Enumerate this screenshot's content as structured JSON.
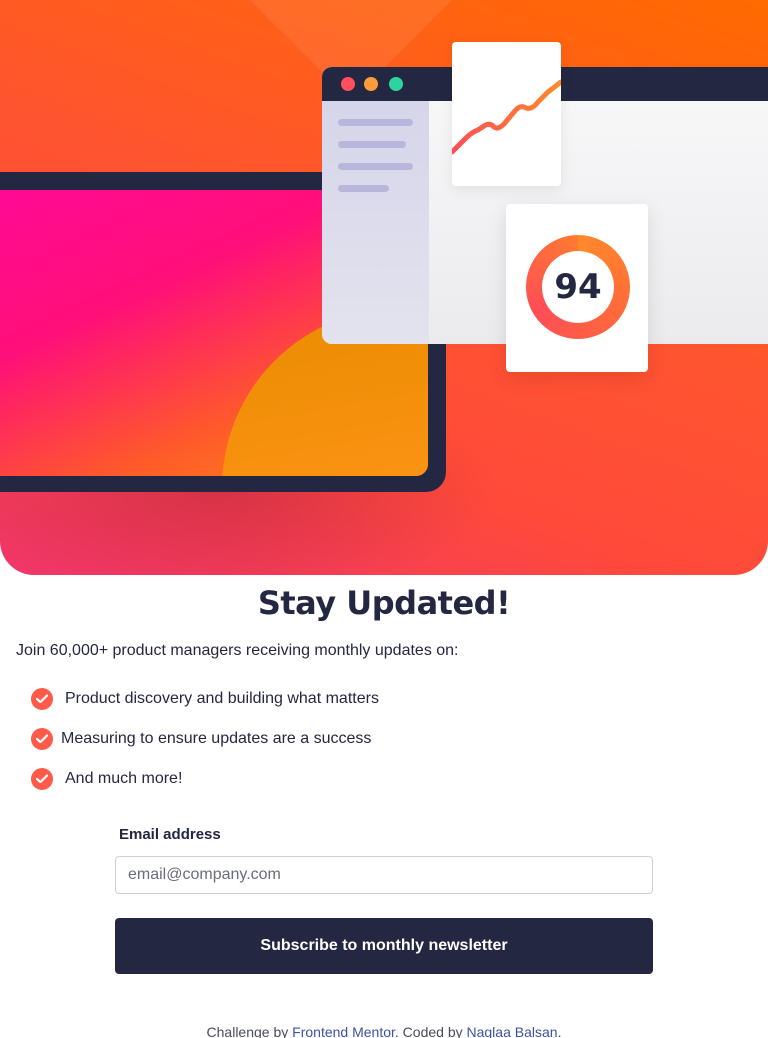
{
  "hero": {
    "score": "94",
    "colors": {
      "accent": "#ff5a4a",
      "dark_navy": "#242742",
      "hero_orange": "#ff6a00",
      "hero_pink": "#ff0a93"
    }
  },
  "content": {
    "title": "Stay Updated!",
    "intro": "Join 60,000+ product managers receiving monthly updates on:",
    "features": [
      {
        "icon": "check-icon",
        "label": "Product discovery and building what matters"
      },
      {
        "icon": "check-icon",
        "label": "Measuring to ensure updates are a success"
      },
      {
        "icon": "check-icon",
        "label": "And much more!"
      }
    ]
  },
  "form": {
    "email_label": "Email address",
    "email_placeholder": "email@company.com",
    "email_value": "",
    "submit_label": "Subscribe to monthly newsletter"
  },
  "attribution": {
    "prefix": "Challenge by ",
    "link1": "Frontend Mentor",
    "middle": ". Coded by ",
    "link2": "Naglaa Balsan",
    "suffix": "."
  }
}
